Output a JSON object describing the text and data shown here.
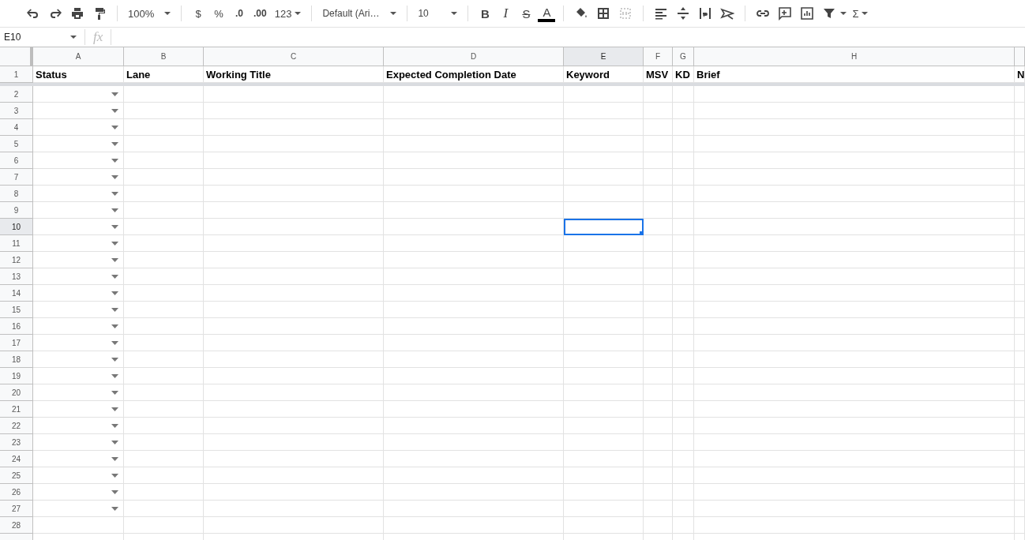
{
  "toolbar": {
    "zoom": "100%",
    "currency": "$",
    "percent": "%",
    "decrease_decimals": ".0",
    "increase_decimals": ".00",
    "more_formats": "123",
    "font": "Default (Ari…",
    "font_size": "10",
    "bold": "B",
    "italic": "I",
    "strikethrough": "S",
    "text_color": "A",
    "functions": "Σ"
  },
  "formula_bar": {
    "name_box": "E10",
    "fx": "fx"
  },
  "columns": [
    {
      "label": "A",
      "selected": false
    },
    {
      "label": "B",
      "selected": false
    },
    {
      "label": "C",
      "selected": false
    },
    {
      "label": "D",
      "selected": false
    },
    {
      "label": "E",
      "selected": true
    },
    {
      "label": "F",
      "selected": false
    },
    {
      "label": "G",
      "selected": false
    },
    {
      "label": "H",
      "selected": false
    }
  ],
  "header_row": {
    "number": "1",
    "cells": [
      "Status",
      "Lane",
      "Working Title",
      "Expected Completion Date",
      "Keyword",
      "MSV",
      "KD",
      "Brief",
      "N"
    ]
  },
  "rows": [
    {
      "number": "2",
      "selected": false,
      "dropdown": true
    },
    {
      "number": "3",
      "selected": false,
      "dropdown": true
    },
    {
      "number": "4",
      "selected": false,
      "dropdown": true
    },
    {
      "number": "5",
      "selected": false,
      "dropdown": true
    },
    {
      "number": "6",
      "selected": false,
      "dropdown": true
    },
    {
      "number": "7",
      "selected": false,
      "dropdown": true
    },
    {
      "number": "8",
      "selected": false,
      "dropdown": true
    },
    {
      "number": "9",
      "selected": false,
      "dropdown": true
    },
    {
      "number": "10",
      "selected": true,
      "dropdown": true
    },
    {
      "number": "11",
      "selected": false,
      "dropdown": true
    },
    {
      "number": "12",
      "selected": false,
      "dropdown": true
    },
    {
      "number": "13",
      "selected": false,
      "dropdown": true
    },
    {
      "number": "14",
      "selected": false,
      "dropdown": true
    },
    {
      "number": "15",
      "selected": false,
      "dropdown": true
    },
    {
      "number": "16",
      "selected": false,
      "dropdown": true
    },
    {
      "number": "17",
      "selected": false,
      "dropdown": true
    },
    {
      "number": "18",
      "selected": false,
      "dropdown": true
    },
    {
      "number": "19",
      "selected": false,
      "dropdown": true
    },
    {
      "number": "20",
      "selected": false,
      "dropdown": true
    },
    {
      "number": "21",
      "selected": false,
      "dropdown": true
    },
    {
      "number": "22",
      "selected": false,
      "dropdown": true
    },
    {
      "number": "23",
      "selected": false,
      "dropdown": true
    },
    {
      "number": "24",
      "selected": false,
      "dropdown": true
    },
    {
      "number": "25",
      "selected": false,
      "dropdown": true
    },
    {
      "number": "26",
      "selected": false,
      "dropdown": true
    },
    {
      "number": "27",
      "selected": false,
      "dropdown": true
    },
    {
      "number": "28",
      "selected": false,
      "dropdown": false
    }
  ]
}
